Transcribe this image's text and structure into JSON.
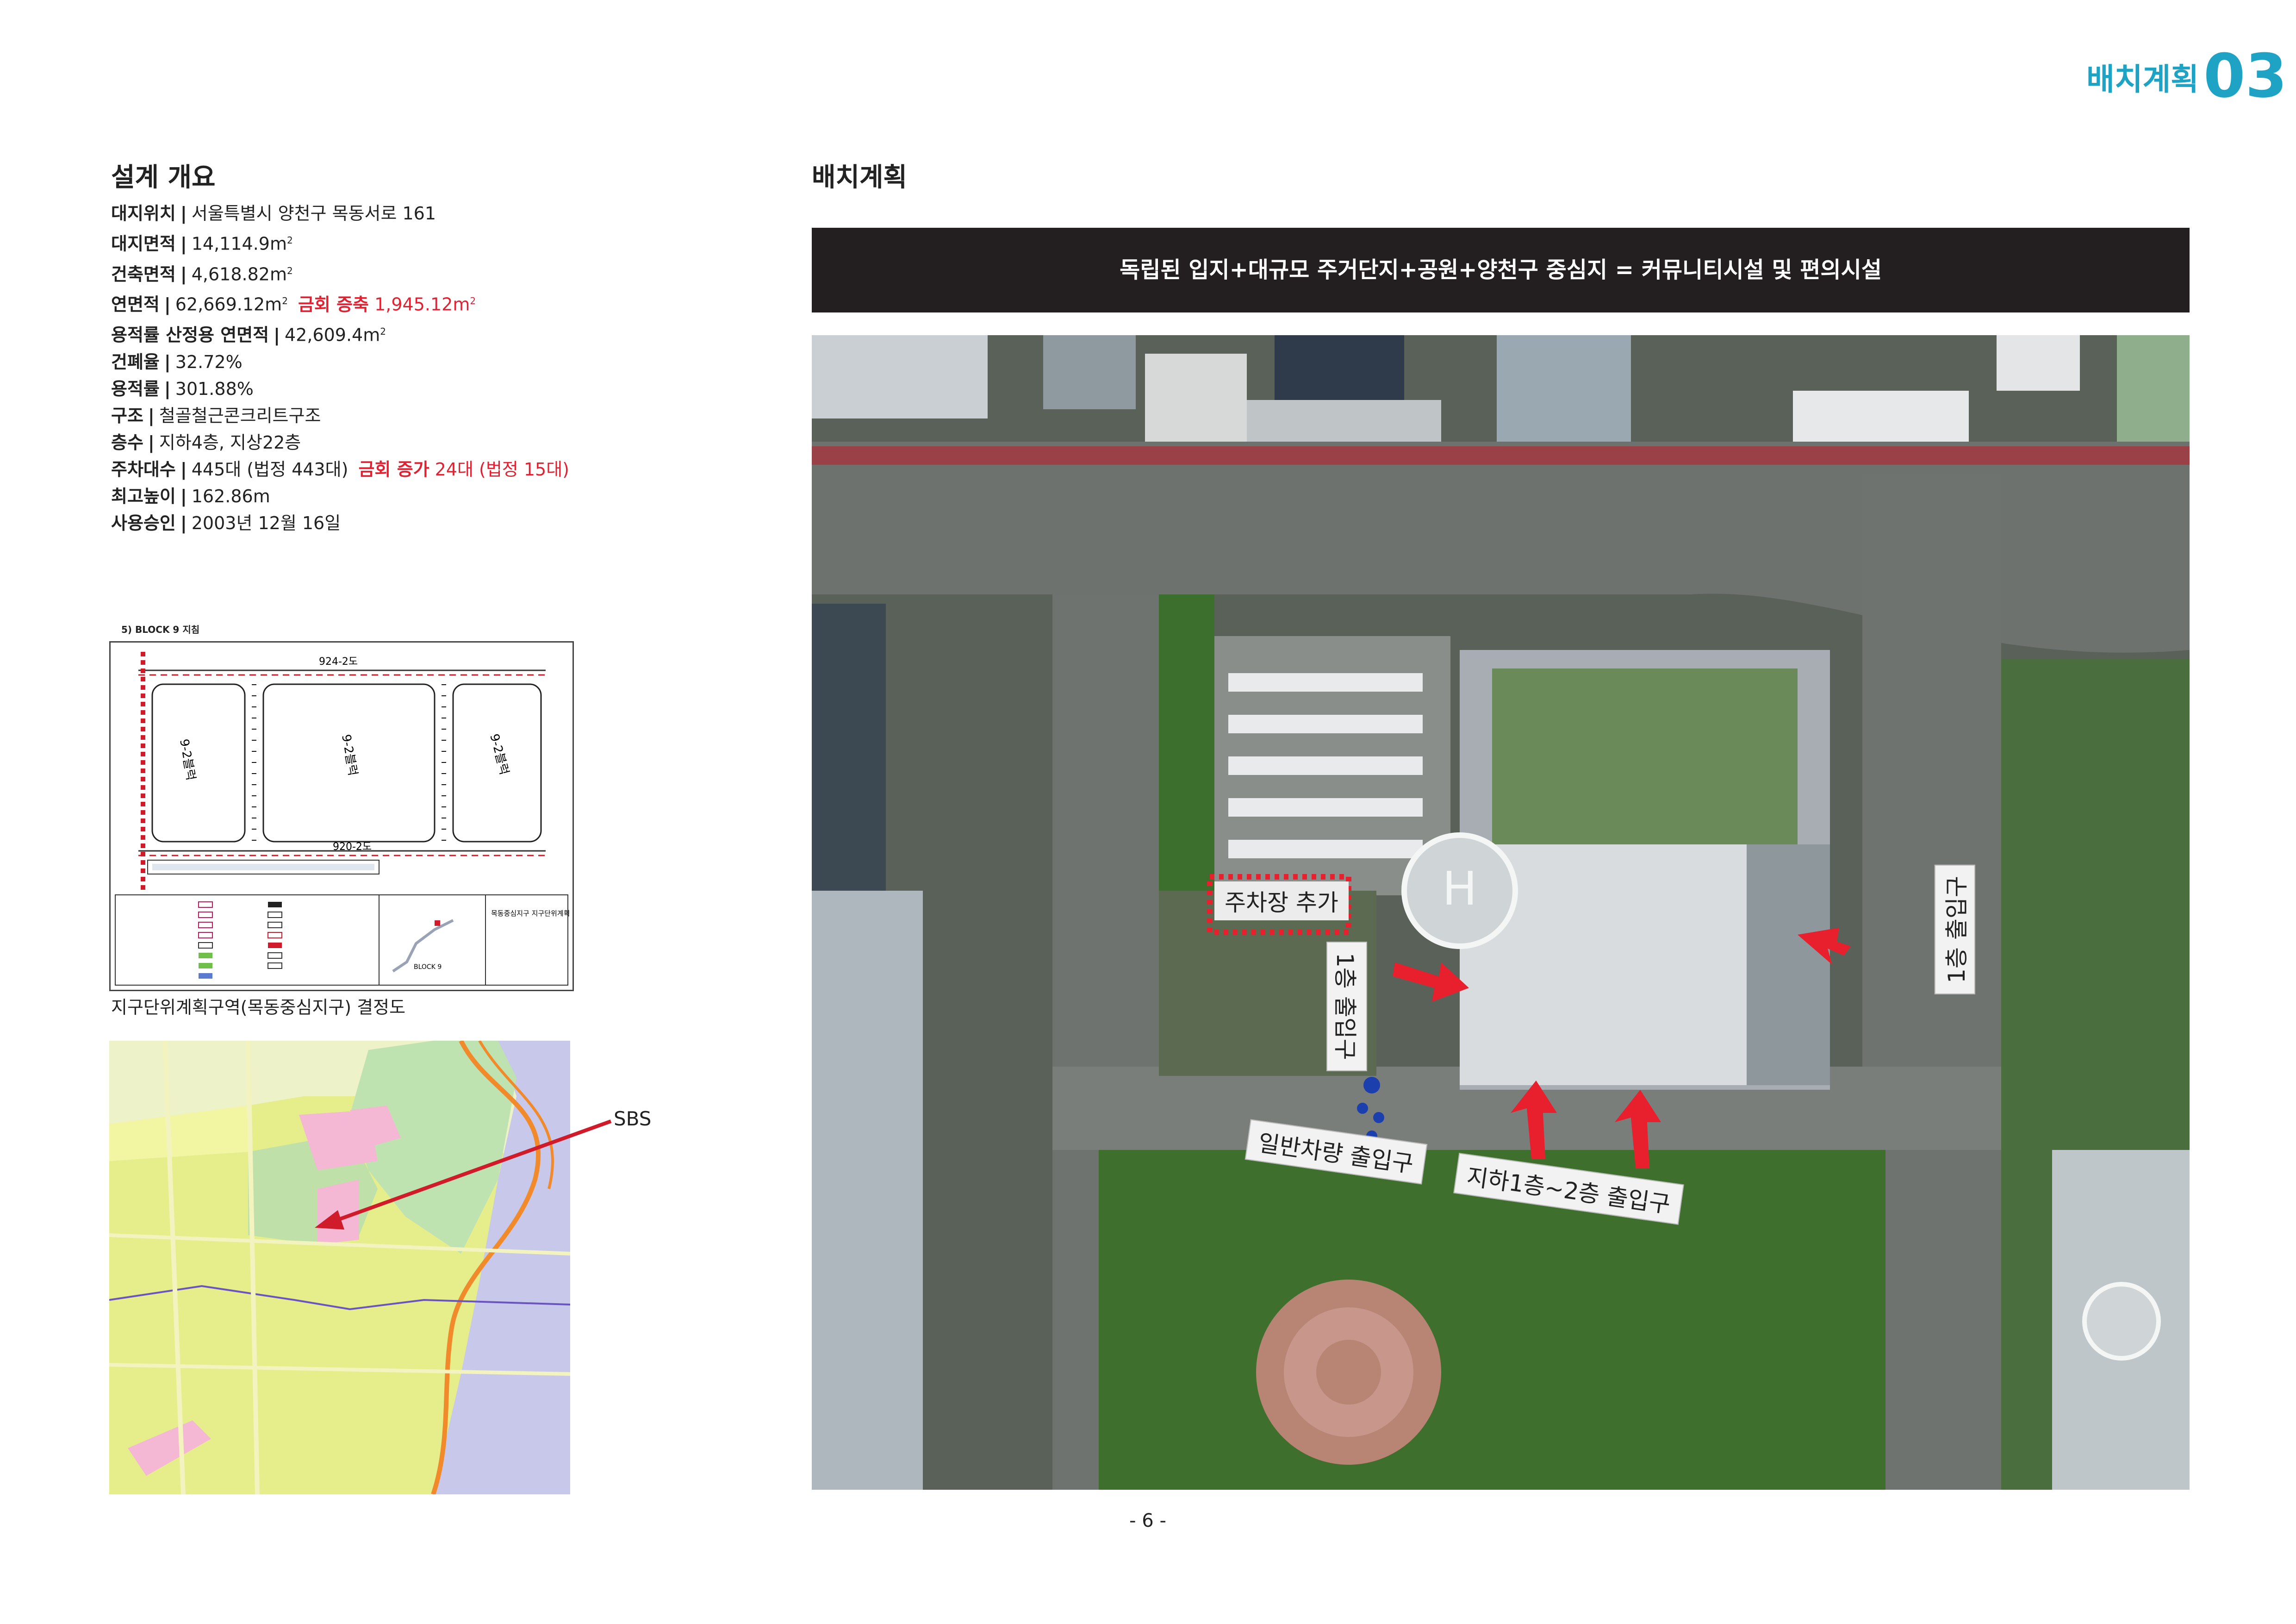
{
  "header": {
    "section": "배치계획",
    "number": "03"
  },
  "overview": {
    "title": "설계 개요",
    "rows": [
      {
        "label": "대지위치",
        "value": "서울특별시 양천구 목동서로 161"
      },
      {
        "label": "대지면적",
        "value": "14,114.9m",
        "sup": "2"
      },
      {
        "label": "건축면적",
        "value": "4,618.82m",
        "sup": "2"
      },
      {
        "label": "연면적",
        "value": "62,669.12m",
        "sup": "2",
        "extra_label": "금회 증축",
        "extra_value": "1,945.12m",
        "extra_sup": "2"
      },
      {
        "label": "용적률 산정용 연면적",
        "value": "42,609.4m",
        "sup": "2"
      },
      {
        "label": "건폐율",
        "value": "32.72%"
      },
      {
        "label": "용적률",
        "value": "301.88%"
      },
      {
        "label": "구조",
        "value": "철골철근콘크리트구조"
      },
      {
        "label": "층수",
        "value": "지하4층, 지상22층"
      },
      {
        "label": "주차대수",
        "value": "445대 (법정 443대)",
        "extra_label": "금회 증가",
        "extra_value": "24대 (법정 15대)"
      },
      {
        "label": "최고높이",
        "value": "162.86m"
      },
      {
        "label": "사용승인",
        "value": "2003년 12월 16일"
      }
    ]
  },
  "map1": {
    "title": "5) BLOCK 9 지침",
    "caption": "지구단위계획구역(목동중심지구) 결정도",
    "road_top": "924-2도",
    "road_bottom": "920-2도",
    "plot_labels": [
      "9-2블럭",
      "9-2블럭",
      "9-2블럭"
    ],
    "legend_title": "목동중심지구 지구단위계획",
    "block_label": "BLOCK 9"
  },
  "map2": {
    "sbs_label": "SBS"
  },
  "site_plan": {
    "title": "배치계획",
    "banner": "독립된 입지+대규모 주거단지+공원+양천구 중심지 = 커뮤니티시설 및 편의시설",
    "labels": {
      "parking_add": "주차장 추가",
      "entrance_1f_left": "1층 출입구",
      "entrance_1f_right": "1층 출입구",
      "vehicle_entrance": "일반차량 출입구",
      "basement_entrance": "지하1층~2층 출입구"
    }
  },
  "footer": {
    "page": "- 6 -"
  },
  "colors": {
    "accent": "#1fa3c5",
    "highlight_red": "#e02233",
    "banner_bg": "#231f20",
    "arrow_red": "#e8202e",
    "arrow_blue": "#1c3fae"
  }
}
